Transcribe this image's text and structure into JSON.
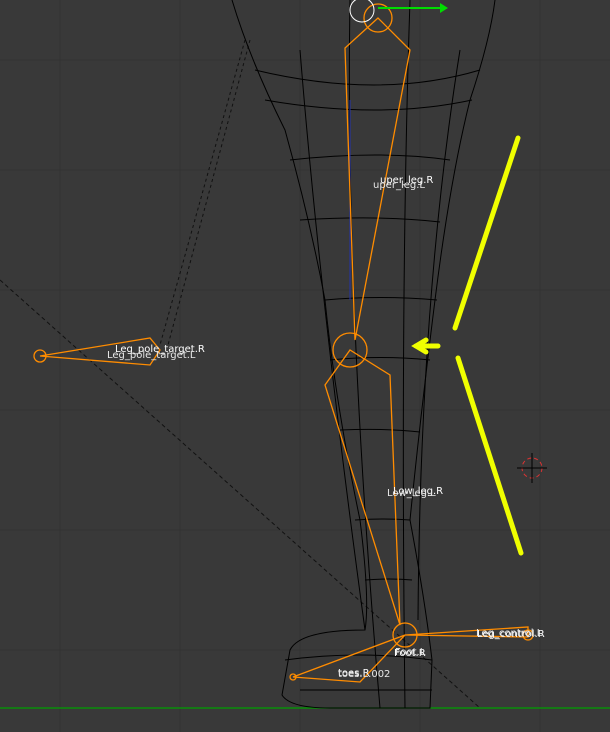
{
  "viewport": {
    "mode": "3D Viewport - Armature edit",
    "colors": {
      "background": "#393939",
      "bone": "#ff8c00",
      "annotation": "#f0ff00",
      "ground": "#00a000"
    },
    "bone_labels": {
      "upper_leg_r": "uper_leg.R",
      "upper_leg_l": "uper_leg.L",
      "pole_target_r": "Leg_pole_target.R",
      "pole_target_l": "Leg_pole_target.L",
      "low_leg_r": "Low_leg.R",
      "low_leg_l": "Low_leg.L",
      "foot_r": "Foot.R",
      "foot_l": "Foot.L",
      "leg_control_r": "Leg_control.R",
      "leg_control_l": "Leg_control.L",
      "toes_r": "toes.R",
      "toes_l": "toes.L.002"
    }
  }
}
